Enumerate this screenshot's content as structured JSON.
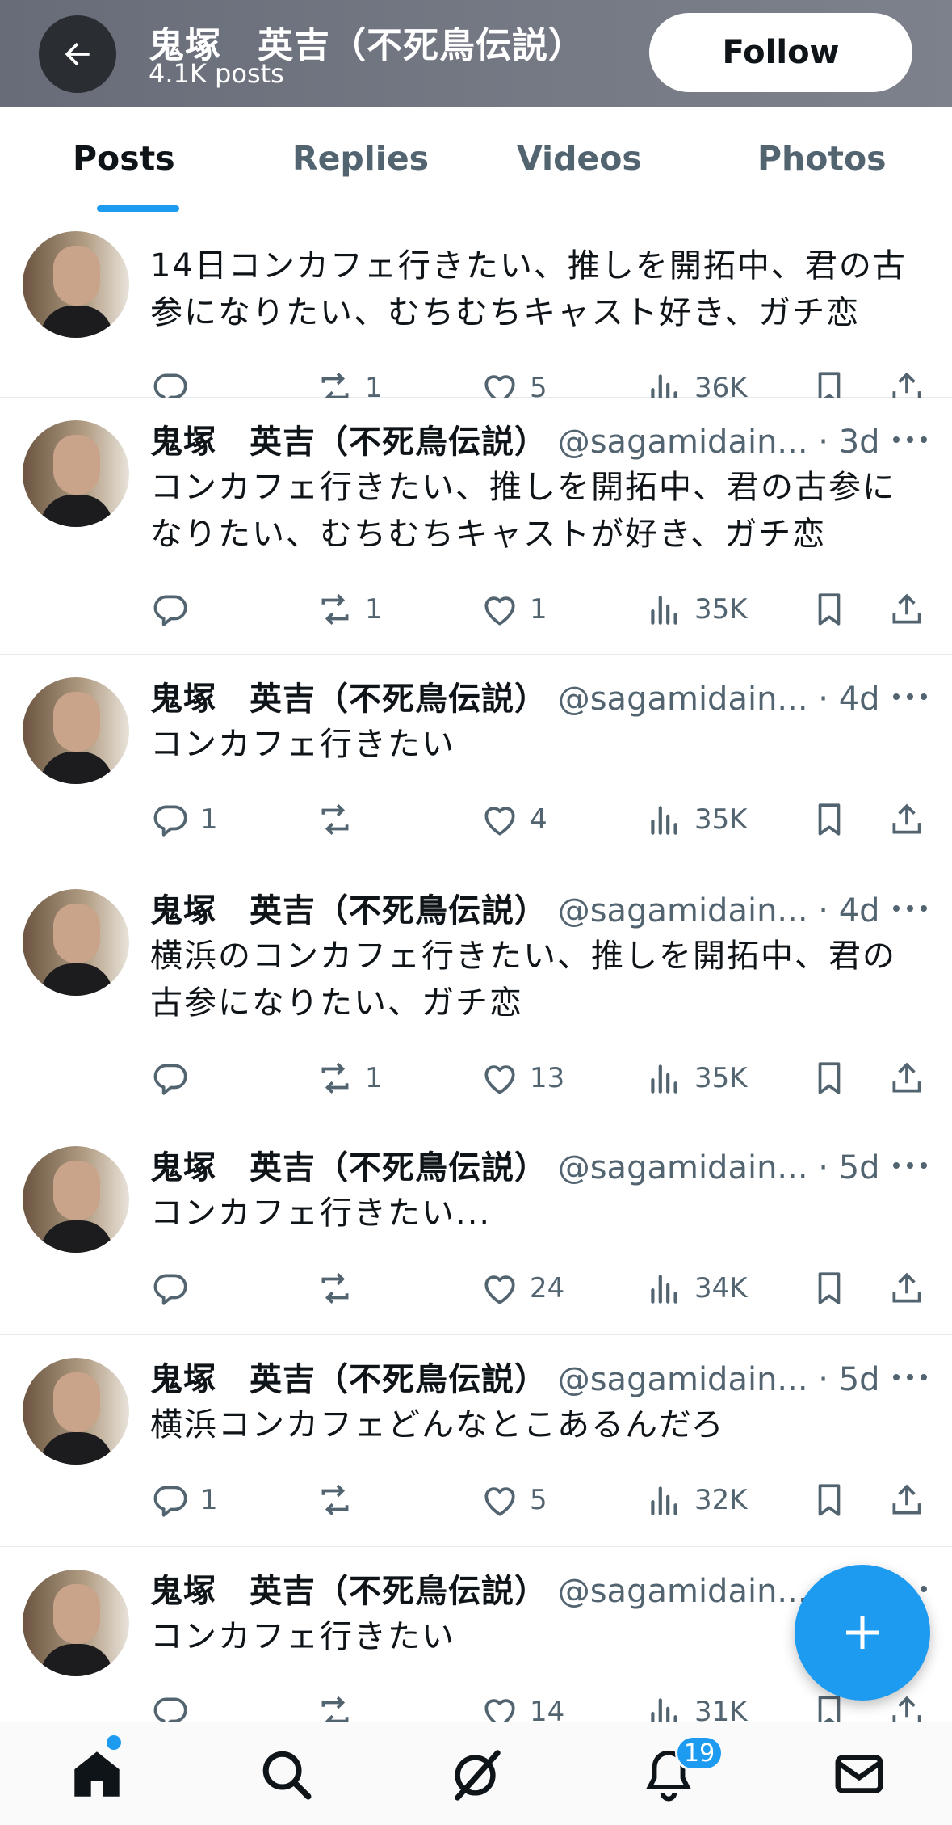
{
  "header": {
    "name": "鬼塚　英吉（不死鳥伝説）",
    "post_count": "4.1K posts",
    "follow_label": "Follow"
  },
  "tabs": [
    {
      "label": "Posts",
      "active": true
    },
    {
      "label": "Replies",
      "active": false
    },
    {
      "label": "Videos",
      "active": false
    },
    {
      "label": "Photos",
      "active": false
    }
  ],
  "posts": [
    {
      "name": "",
      "handle": "",
      "time": "",
      "text": "14日コンカフェ行きたい、推しを開拓中、君の古参になりたい、むちむちキャスト好き、ガチ恋",
      "replies": "",
      "reposts": "1",
      "likes": "5",
      "views": "36K"
    },
    {
      "name": "鬼塚　英吉（不死鳥伝説）",
      "handle": "@sagamidain...",
      "time": "· 3d",
      "text": "コンカフェ行きたい、推しを開拓中、君の古参になりたい、むちむちキャストが好き、ガチ恋",
      "replies": "",
      "reposts": "1",
      "likes": "1",
      "views": "35K"
    },
    {
      "name": "鬼塚　英吉（不死鳥伝説）",
      "handle": "@sagamidain...",
      "time": "· 4d",
      "text": "コンカフェ行きたい",
      "replies": "1",
      "reposts": "",
      "likes": "4",
      "views": "35K"
    },
    {
      "name": "鬼塚　英吉（不死鳥伝説）",
      "handle": "@sagamidain...",
      "time": "· 4d",
      "text": "横浜のコンカフェ行きたい、推しを開拓中、君の古参になりたい、ガチ恋",
      "replies": "",
      "reposts": "1",
      "likes": "13",
      "views": "35K"
    },
    {
      "name": "鬼塚　英吉（不死鳥伝説）",
      "handle": "@sagamidain...",
      "time": "· 5d",
      "text": "コンカフェ行きたい...",
      "replies": "",
      "reposts": "",
      "likes": "24",
      "views": "34K"
    },
    {
      "name": "鬼塚　英吉（不死鳥伝説）",
      "handle": "@sagamidain...",
      "time": "· 5d",
      "text": "横浜コンカフェどんなとこあるんだろ",
      "replies": "1",
      "reposts": "",
      "likes": "5",
      "views": "32K"
    },
    {
      "name": "鬼塚　英吉（不死鳥伝説）",
      "handle": "@sagamidain...",
      "time": "",
      "text": "コンカフェ行きたい",
      "replies": "",
      "reposts": "",
      "likes": "14",
      "views": "31K"
    }
  ],
  "bottom_nav": {
    "items": [
      "home-icon",
      "search-icon",
      "grok-icon",
      "notifications-icon",
      "messages-icon"
    ],
    "notification_badge": "19"
  },
  "colors": {
    "accent": "#1d9bf0",
    "text_primary": "#0f1419",
    "text_secondary": "#536471"
  }
}
